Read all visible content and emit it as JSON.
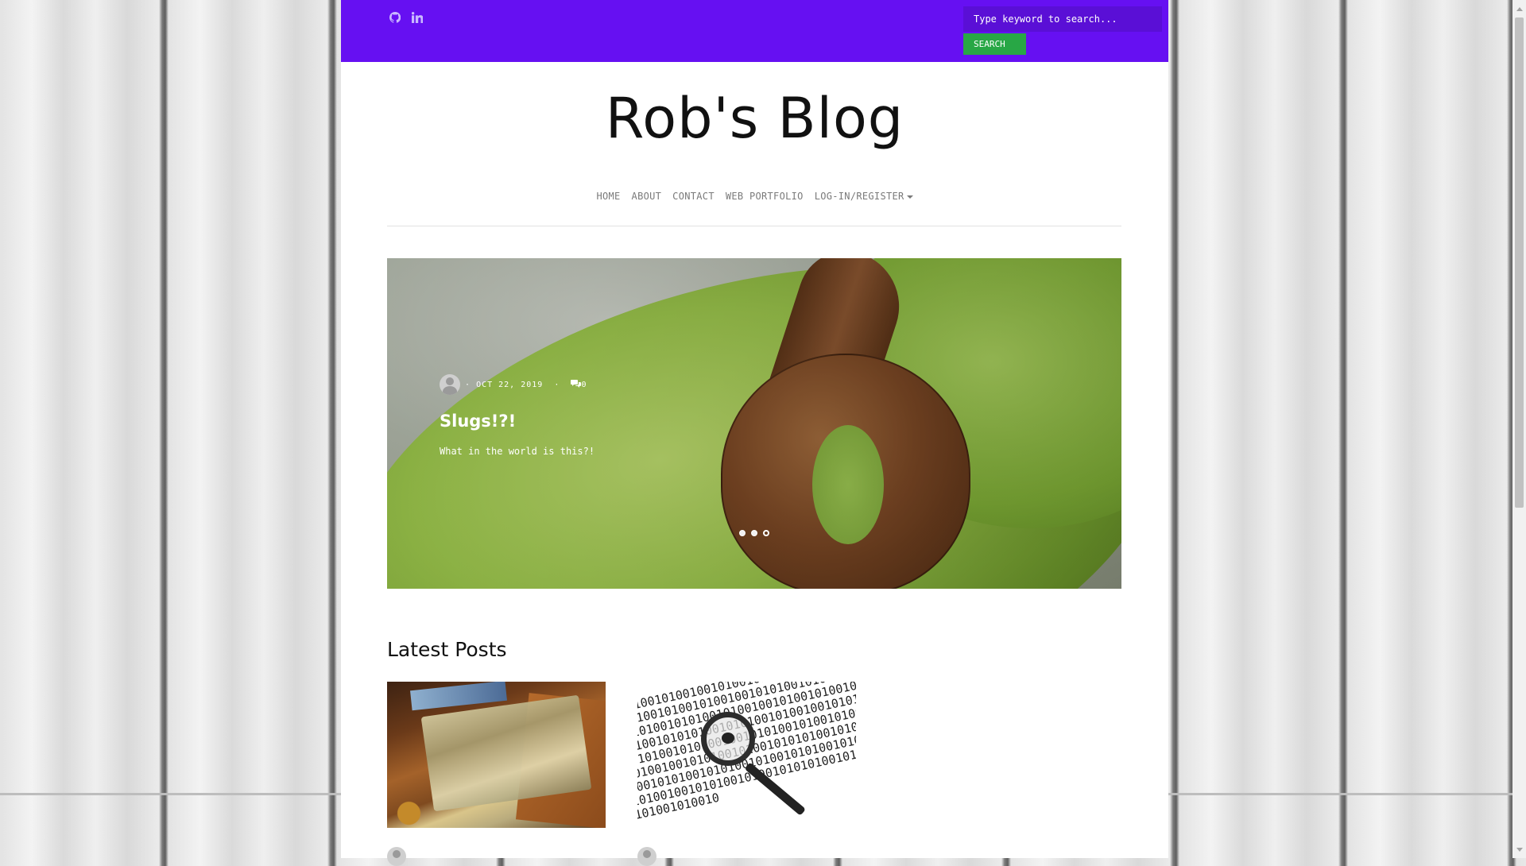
{
  "topbar": {
    "social": [
      {
        "icon": "github-icon"
      },
      {
        "icon": "linkedin-icon"
      }
    ],
    "search": {
      "placeholder": "Type keyword to search...",
      "button_label": "SEARCH"
    }
  },
  "site": {
    "title": "Rob's Blog"
  },
  "nav": {
    "items": [
      "HOME",
      "ABOUT",
      "CONTACT",
      "WEB PORTFOLIO",
      "LOG-IN/REGISTER"
    ]
  },
  "hero": {
    "meta": {
      "separator": "·",
      "date": "OCT 22, 2019",
      "comment_count": "0"
    },
    "title": "Slugs!?!",
    "subtitle": "What in the world is this?!",
    "carousel": {
      "slides": 3,
      "active_index": 2
    }
  },
  "latest": {
    "heading": "Latest Posts",
    "posts": [
      {
        "image": "wallet-cash-image"
      },
      {
        "image": "binary-magnifier-image"
      }
    ]
  },
  "colors": {
    "topbar": "#6610f2",
    "search_button": "#28a745",
    "nav_text": "#7a7a7a"
  }
}
